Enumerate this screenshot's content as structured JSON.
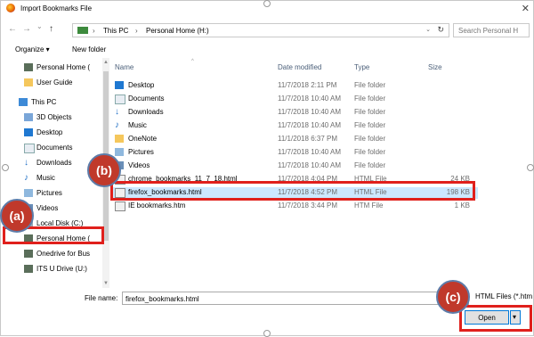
{
  "window": {
    "title": "Import Bookmarks File",
    "close_glyph": "✕"
  },
  "nav": {
    "back_glyph": "←",
    "forward_glyph": "→",
    "recent_glyph": "⌄",
    "up_glyph": "↑",
    "breadcrumb": [
      "This PC",
      "Personal Home (H:)"
    ],
    "separator": "›",
    "dropdown_glyph": "⌄",
    "refresh_glyph": "↻",
    "search_placeholder": "Search Personal H"
  },
  "commands": {
    "organize": "Organize ▾",
    "new_folder": "New folder"
  },
  "sidebar": {
    "items": [
      {
        "label": "Personal Home (",
        "icon": "drive-icon"
      },
      {
        "label": "User Guide",
        "icon": "folder-icon"
      },
      {
        "label": "This PC",
        "icon": "pc-icon"
      },
      {
        "label": "3D Objects",
        "icon": "3d-objects-icon"
      },
      {
        "label": "Desktop",
        "icon": "desktop-icon"
      },
      {
        "label": "Documents",
        "icon": "documents-icon"
      },
      {
        "label": "Downloads",
        "icon": "downloads-icon"
      },
      {
        "label": "Music",
        "icon": "music-icon"
      },
      {
        "label": "Pictures",
        "icon": "pictures-icon"
      },
      {
        "label": "Videos",
        "icon": "videos-icon"
      },
      {
        "label": "Local Disk (C:)",
        "icon": "disk-icon"
      },
      {
        "label": "Personal Home (",
        "icon": "drive-icon"
      },
      {
        "label": "Onedrive for Bus",
        "icon": "drive-icon"
      },
      {
        "label": "ITS U Drive (U:)",
        "icon": "drive-icon"
      }
    ]
  },
  "columns": {
    "name": "Name",
    "date": "Date modified",
    "type": "Type",
    "size": "Size"
  },
  "files": [
    {
      "name": "Desktop",
      "date": "11/7/2018 2:11 PM",
      "type": "File folder",
      "size": "",
      "icon": "desktop-icon"
    },
    {
      "name": "Documents",
      "date": "11/7/2018 10:40 AM",
      "type": "File folder",
      "size": "",
      "icon": "documents-icon"
    },
    {
      "name": "Downloads",
      "date": "11/7/2018 10:40 AM",
      "type": "File folder",
      "size": "",
      "icon": "downloads-icon"
    },
    {
      "name": "Music",
      "date": "11/7/2018 10:40 AM",
      "type": "File folder",
      "size": "",
      "icon": "music-icon"
    },
    {
      "name": "OneNote",
      "date": "11/1/2018 6:37 PM",
      "type": "File folder",
      "size": "",
      "icon": "folder-icon"
    },
    {
      "name": "Pictures",
      "date": "11/7/2018 10:40 AM",
      "type": "File folder",
      "size": "",
      "icon": "pictures-icon"
    },
    {
      "name": "Videos",
      "date": "11/7/2018 10:40 AM",
      "type": "File folder",
      "size": "",
      "icon": "videos-icon"
    },
    {
      "name": "chrome_bookmarks_11_7_18.html",
      "date": "11/7/2018 4:04 PM",
      "type": "HTML File",
      "size": "24 KB",
      "icon": "html-file-icon"
    },
    {
      "name": "firefox_bookmarks.html",
      "date": "11/7/2018 4:52 PM",
      "type": "HTML File",
      "size": "198 KB",
      "icon": "html-file-icon"
    },
    {
      "name": "IE bookmarks.htm",
      "date": "11/7/2018 3:44 PM",
      "type": "HTM File",
      "size": "1 KB",
      "icon": "html-file-icon"
    }
  ],
  "footer": {
    "file_name_label": "File name:",
    "file_name_value": "firefox_bookmarks.html",
    "file_type": "HTML Files (*.htm",
    "open_label": "Open",
    "open_arrow": "▾"
  },
  "annotations": {
    "a": "(a)",
    "b": "(b)",
    "c": "(c)"
  },
  "colors": {
    "selection": "#cce8ff",
    "annotation_red": "#e0201c",
    "badge_fill": "#c0392b"
  }
}
